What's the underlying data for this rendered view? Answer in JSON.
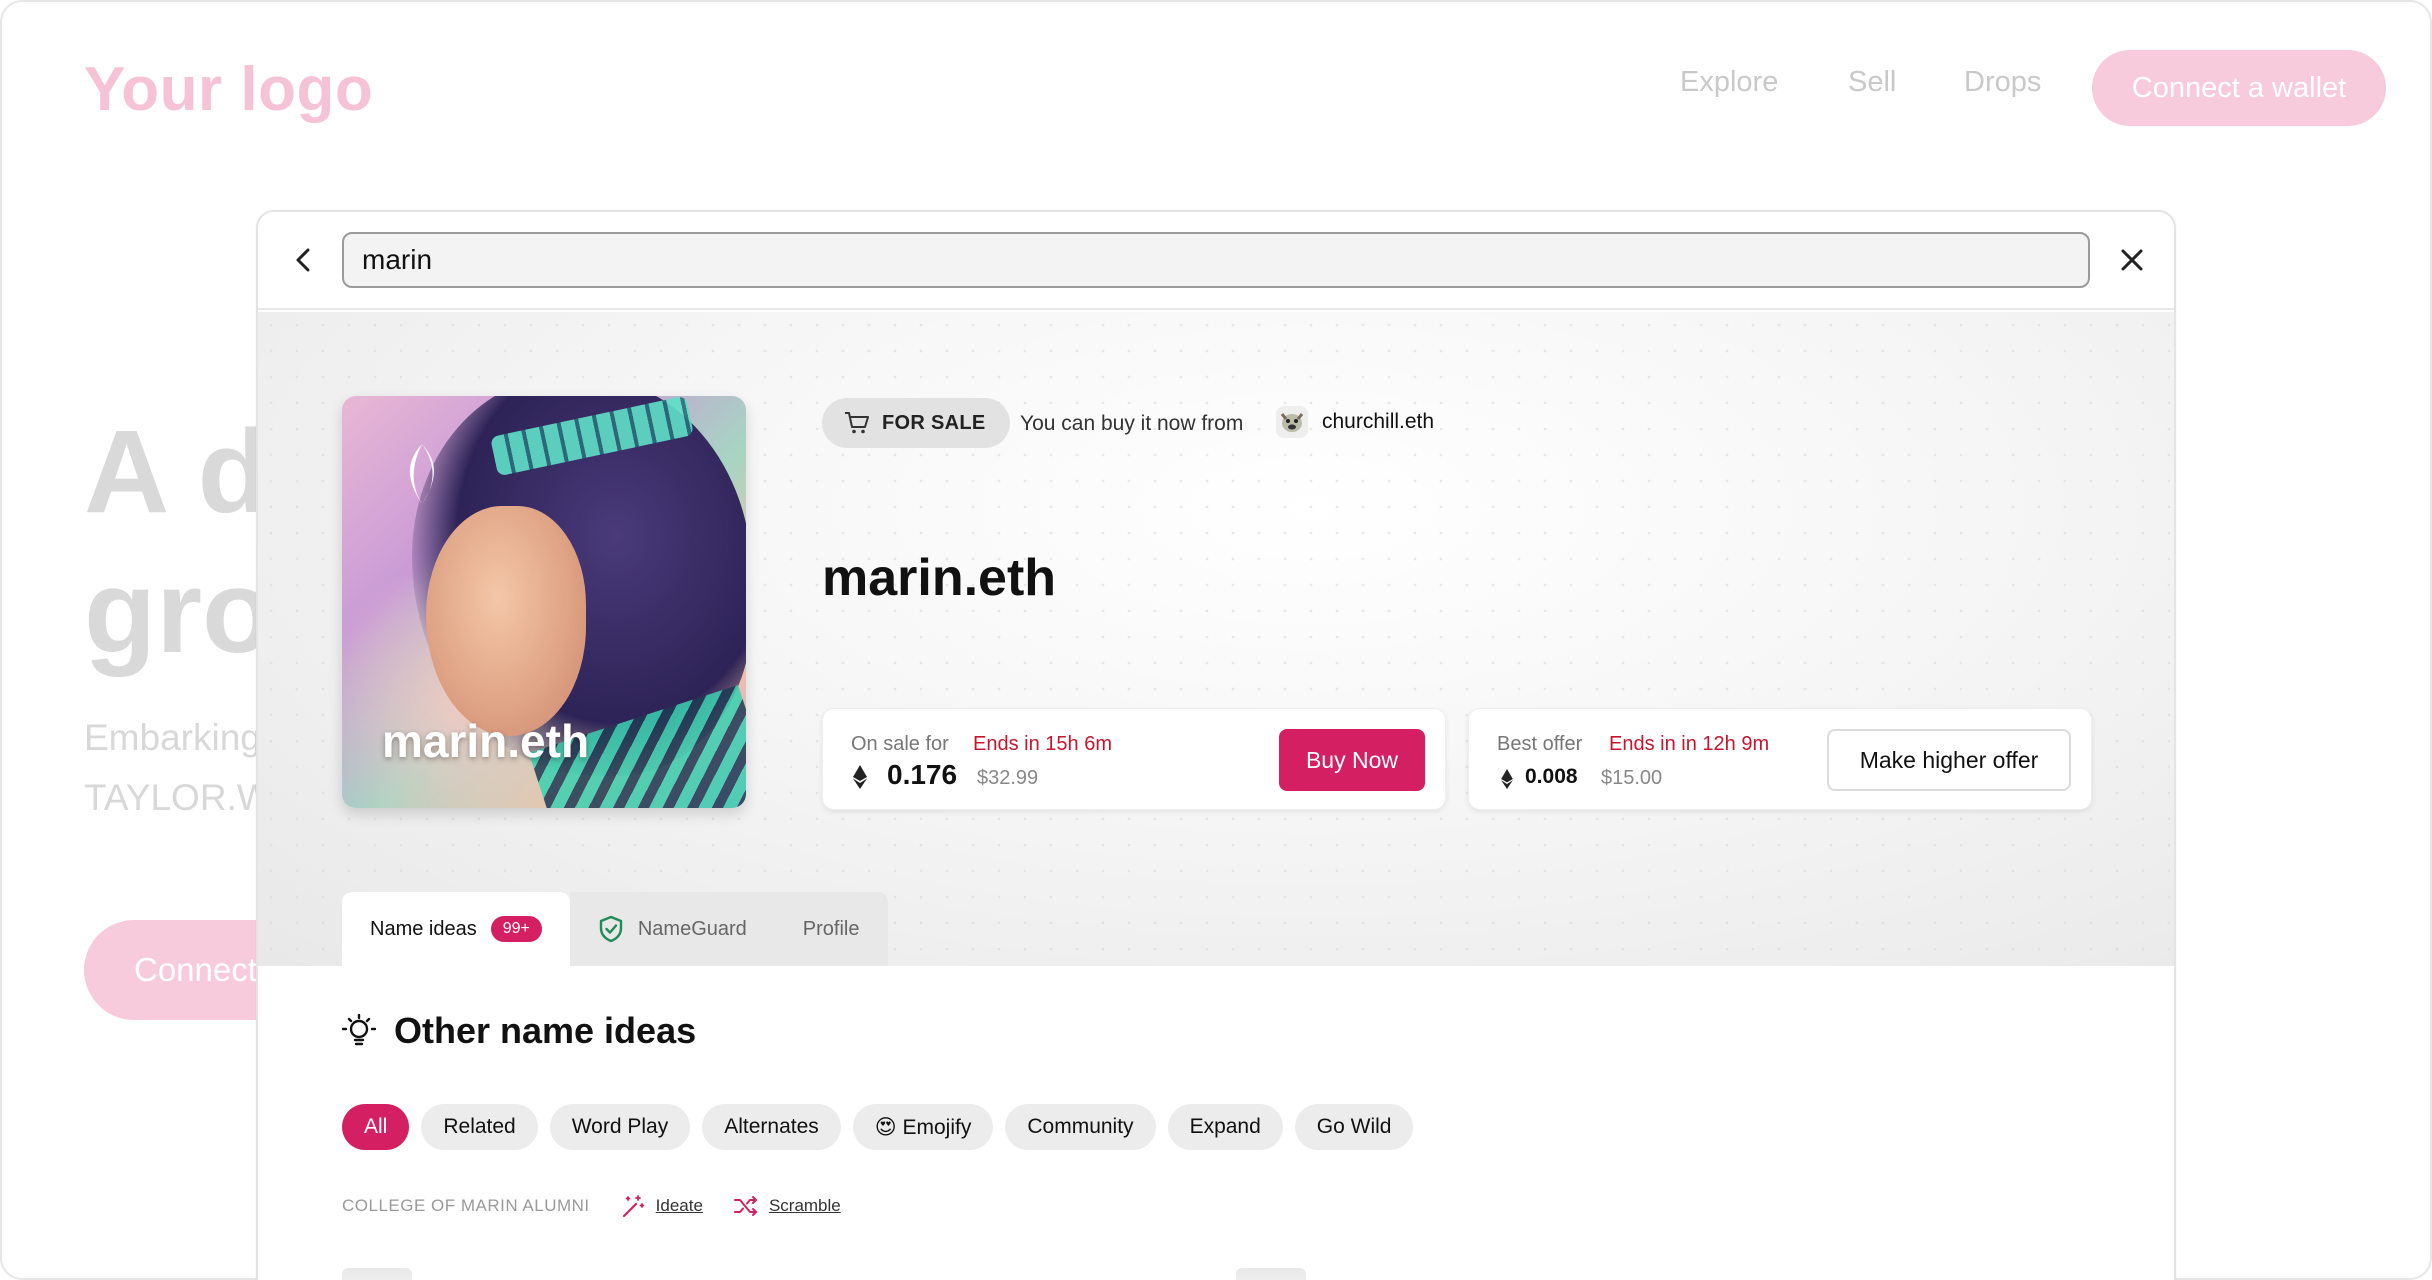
{
  "background": {
    "logo": "Your logo",
    "nav": [
      "Explore",
      "Sell",
      "Drops"
    ],
    "connect_wallet": "Connect a wallet",
    "hero_line1": "A d",
    "hero_line2": "gro",
    "sub_line1": "Embarking",
    "sub_line2": "TAYLOR.W",
    "connect_hero": "Connect"
  },
  "search": {
    "value": "marin",
    "back_icon": "chevron-left-icon",
    "close_icon": "close-icon"
  },
  "listing": {
    "image_label": "marin.eth",
    "status_pill": "FOR SALE",
    "status_text": "You can buy it now from",
    "owner_name": "churchill.eth",
    "domain_name": "marin.eth",
    "sale": {
      "label": "On sale for",
      "ends": "Ends in 15h 6m",
      "amount": "0.176",
      "usd": "$32.99",
      "button": "Buy Now"
    },
    "offer": {
      "label": "Best offer",
      "ends": "Ends in in 12h 9m",
      "amount": "0.008",
      "usd": "$15.00",
      "button": "Make higher offer"
    }
  },
  "tabs": [
    {
      "label": "Name ideas",
      "badge": "99+",
      "active": true
    },
    {
      "label": "NameGuard",
      "icon": "shield-check-icon"
    },
    {
      "label": "Profile"
    }
  ],
  "ideas": {
    "title": "Other name ideas",
    "chips": [
      "All",
      "Related",
      "Word Play",
      "Alternates",
      "😍 Emojify",
      "Community",
      "Expand",
      "Go Wild"
    ],
    "active_chip": "All",
    "caption": "COLLEGE OF MARIN ALUMNI",
    "links": [
      "Ideate",
      "Scramble"
    ]
  },
  "colors": {
    "accent": "#d41f63",
    "ends_red": "#c5162f",
    "bg_pink": "#f7cbdb"
  }
}
